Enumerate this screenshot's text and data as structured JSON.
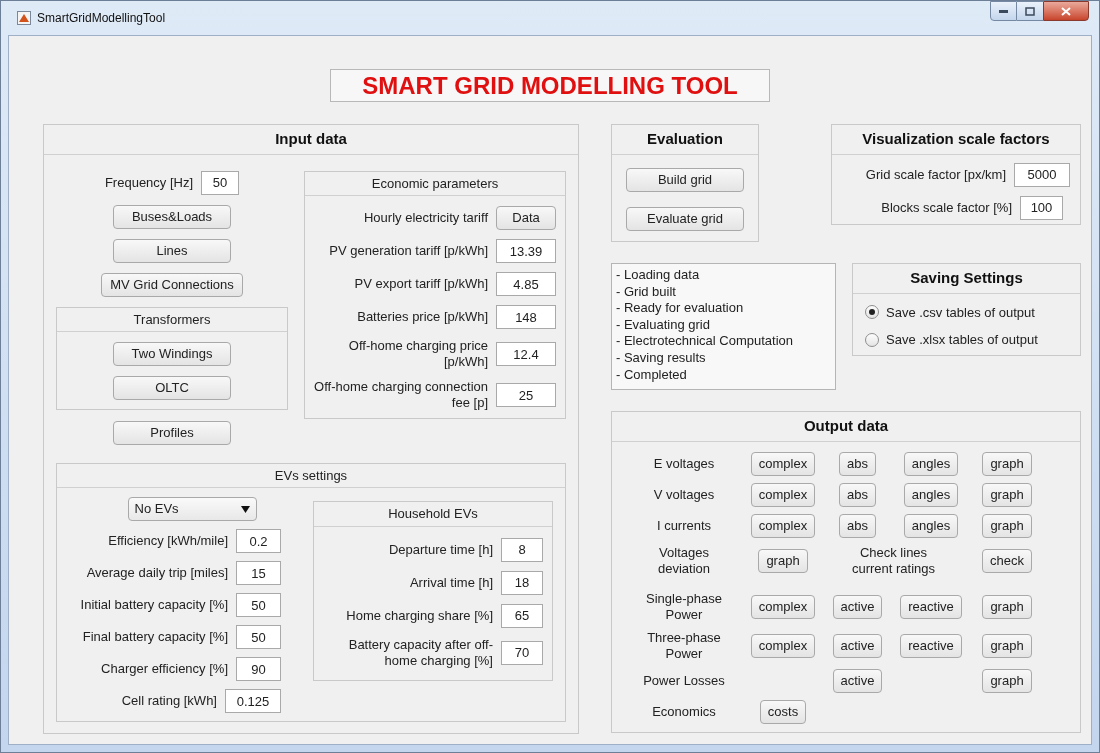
{
  "window": {
    "title": "SmartGridModellingTool"
  },
  "app_title": "SMART GRID MODELLING TOOL",
  "input_data": {
    "title": "Input data",
    "frequency": {
      "label": "Frequency [Hz]",
      "value": "50"
    },
    "buttons": [
      "Buses&Loads",
      "Lines",
      "MV Grid Connections"
    ],
    "transformers": {
      "title": "Transformers",
      "buttons": [
        "Two Windings",
        "OLTC"
      ]
    },
    "profiles_button": "Profiles",
    "economic_parameters": {
      "title": "Economic parameters",
      "rows": [
        {
          "label": "Hourly electricity tariff",
          "kind": "button",
          "value": "Data"
        },
        {
          "label": "PV generation tariff [p/kWh]",
          "kind": "field",
          "value": "13.39"
        },
        {
          "label": "PV export tariff [p/kWh]",
          "kind": "field",
          "value": "4.85"
        },
        {
          "label": "Batteries price [p/kWh]",
          "kind": "field",
          "value": "148"
        },
        {
          "label": "Off-home charging price [p/kWh]",
          "kind": "field",
          "value": "12.4"
        },
        {
          "label": "Off-home charging connection fee [p]",
          "kind": "field",
          "value": "25"
        }
      ]
    },
    "evs_settings": {
      "title": "EVs settings",
      "dropdown": {
        "value": "No EVs"
      },
      "fields": [
        {
          "label": "Efficiency [kWh/mile]",
          "value": "0.2"
        },
        {
          "label": "Average daily trip [miles]",
          "value": "15"
        },
        {
          "label": "Initial battery capacity [%]",
          "value": "50"
        },
        {
          "label": "Final battery capacity [%]",
          "value": "50"
        },
        {
          "label": "Charger efficiency [%]",
          "value": "90"
        },
        {
          "label": "Cell rating [kWh]",
          "value": "0.125"
        }
      ],
      "household_evs": {
        "title": "Household EVs",
        "fields": [
          {
            "label": "Departure time [h]",
            "value": "8"
          },
          {
            "label": "Arrival time [h]",
            "value": "18"
          },
          {
            "label": "Home charging share [%]",
            "value": "65"
          },
          {
            "label": "Battery capacity after off-home charging [%]",
            "value": "70"
          }
        ]
      }
    }
  },
  "evaluation": {
    "title": "Evaluation",
    "buttons": [
      "Build grid",
      "Evaluate grid"
    ]
  },
  "visualization": {
    "title": "Visualization scale factors",
    "fields": [
      {
        "label": "Grid scale factor [px/km]",
        "value": "5000"
      },
      {
        "label": "Blocks scale factor [%]",
        "value": "100"
      }
    ]
  },
  "log": [
    "- Loading data",
    "- Grid built",
    "- Ready for evaluation",
    "- Evaluating grid",
    "- Electrotechnical Computation",
    "- Saving results",
    "- Completed"
  ],
  "saving_settings": {
    "title": "Saving Settings",
    "options": [
      {
        "label": "Save .csv tables of output",
        "selected": true
      },
      {
        "label": "Save .xlsx tables of output",
        "selected": false
      }
    ]
  },
  "output_data": {
    "title": "Output data",
    "row_groups": [
      [
        {
          "label": "E voltages",
          "cells": [
            {
              "kind": "button",
              "text": "complex"
            },
            {
              "kind": "button",
              "text": "abs"
            },
            {
              "kind": "button",
              "text": "angles"
            },
            {
              "kind": "button",
              "text": "graph"
            }
          ]
        },
        {
          "label": "V voltages",
          "cells": [
            {
              "kind": "button",
              "text": "complex"
            },
            {
              "kind": "button",
              "text": "abs"
            },
            {
              "kind": "button",
              "text": "angles"
            },
            {
              "kind": "button",
              "text": "graph"
            }
          ]
        },
        {
          "label": "I currents",
          "cells": [
            {
              "kind": "button",
              "text": "complex"
            },
            {
              "kind": "button",
              "text": "abs"
            },
            {
              "kind": "button",
              "text": "angles"
            },
            {
              "kind": "button",
              "text": "graph"
            }
          ]
        },
        {
          "label": "Voltages deviation",
          "cells": [
            {
              "kind": "button",
              "text": "graph"
            },
            {
              "kind": "wide_text",
              "text": "Check lines current ratings"
            },
            {
              "kind": "button",
              "text": "check"
            }
          ]
        }
      ],
      [
        {
          "label": "Single-phase Power",
          "cells": [
            {
              "kind": "button",
              "text": "complex"
            },
            {
              "kind": "button",
              "text": "active"
            },
            {
              "kind": "button",
              "text": "reactive"
            },
            {
              "kind": "button",
              "text": "graph"
            }
          ]
        },
        {
          "label": "Three-phase Power",
          "cells": [
            {
              "kind": "button",
              "text": "complex"
            },
            {
              "kind": "button",
              "text": "active"
            },
            {
              "kind": "button",
              "text": "reactive"
            },
            {
              "kind": "button",
              "text": "graph"
            }
          ]
        },
        {
          "label": "Power Losses",
          "cells": [
            {
              "kind": "gap"
            },
            {
              "kind": "button",
              "text": "active"
            },
            {
              "kind": "gap"
            },
            {
              "kind": "button",
              "text": "graph"
            }
          ]
        },
        {
          "label": "Economics",
          "cells": [
            {
              "kind": "button",
              "text": "costs"
            }
          ]
        }
      ]
    ]
  }
}
